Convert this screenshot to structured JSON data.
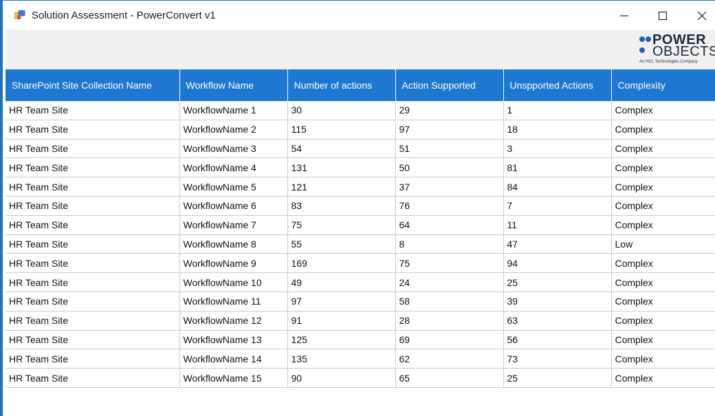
{
  "window": {
    "title": "Solution Assessment - PowerConvert v1"
  },
  "logo": {
    "line1": "POWER",
    "line2": "OBJECTS",
    "tagline": "An HCL Technologies Company"
  },
  "table": {
    "columns": [
      "SharePoint Site Collection Name",
      "Workflow Name",
      "Number of actions",
      "Action Supported",
      "Unspported Actions",
      "Complexity"
    ],
    "rows": [
      [
        "HR Team Site",
        "WorkflowName 1",
        "30",
        "29",
        "1",
        "Complex"
      ],
      [
        "HR Team Site",
        "WorkflowName 2",
        "115",
        "97",
        "18",
        "Complex"
      ],
      [
        "HR Team Site",
        "WorkflowName 3",
        "54",
        "51",
        "3",
        "Complex"
      ],
      [
        "HR Team Site",
        "WorkflowName 4",
        "131",
        "50",
        "81",
        "Complex"
      ],
      [
        "HR Team Site",
        "WorkflowName 5",
        "121",
        "37",
        "84",
        "Complex"
      ],
      [
        "HR Team Site",
        "WorkflowName 6",
        "83",
        "76",
        "7",
        "Complex"
      ],
      [
        "HR Team Site",
        "WorkflowName 7",
        "75",
        "64",
        "11",
        "Complex"
      ],
      [
        "HR Team Site",
        "WorkflowName 8",
        "55",
        "8",
        "47",
        "Low"
      ],
      [
        "HR Team Site",
        "WorkflowName 9",
        "169",
        "75",
        "94",
        "Complex"
      ],
      [
        "HR Team Site",
        "WorkflowName 10",
        "49",
        "24",
        "25",
        "Complex"
      ],
      [
        "HR Team Site",
        "WorkflowName 11",
        "97",
        "58",
        "39",
        "Complex"
      ],
      [
        "HR Team Site",
        "WorkflowName 12",
        "91",
        "28",
        "63",
        "Complex"
      ],
      [
        "HR Team Site",
        "WorkflowName 13",
        "125",
        "69",
        "56",
        "Complex"
      ],
      [
        "HR Team Site",
        "WorkflowName 14",
        "135",
        "62",
        "73",
        "Complex"
      ],
      [
        "HR Team Site",
        "WorkflowName 15",
        "90",
        "65",
        "25",
        "Complex"
      ]
    ]
  },
  "colors": {
    "header_bg": "#1e78d2",
    "frame_accent": "#1e73c6"
  },
  "icons": {
    "app": "app-icon",
    "minimize": "minimize-icon",
    "maximize": "maximize-icon",
    "close": "close-icon"
  }
}
